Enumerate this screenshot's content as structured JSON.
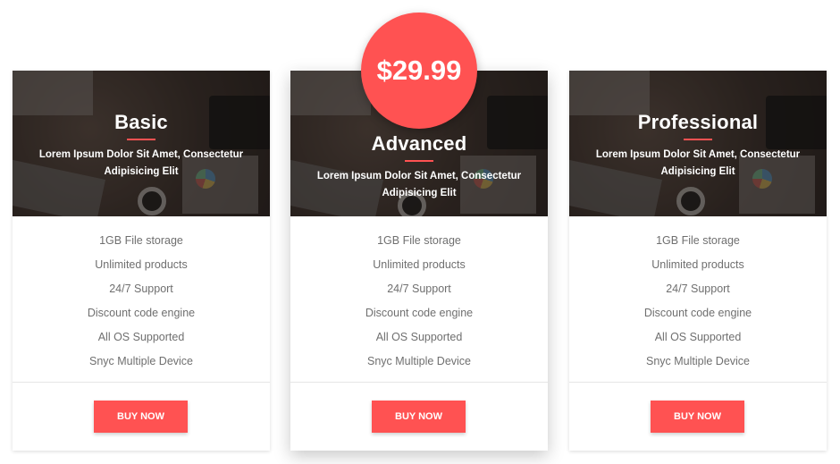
{
  "accent_color": "#ff5252",
  "featured_price": "$29.99",
  "plans": [
    {
      "name": "Basic",
      "description": "Lorem Ipsum Dolor Sit Amet, Consectetur Adipisicing Elit",
      "features": [
        "1GB File storage",
        "Unlimited products",
        "24/7 Support",
        "Discount code engine",
        "All OS Supported",
        "Snyc Multiple Device"
      ],
      "button_label": "BUY NOW"
    },
    {
      "name": "Advanced",
      "description": "Lorem Ipsum Dolor Sit Amet, Consectetur Adipisicing Elit",
      "features": [
        "1GB File storage",
        "Unlimited products",
        "24/7 Support",
        "Discount code engine",
        "All OS Supported",
        "Snyc Multiple Device"
      ],
      "button_label": "BUY NOW"
    },
    {
      "name": "Professional",
      "description": "Lorem Ipsum Dolor Sit Amet, Consectetur Adipisicing Elit",
      "features": [
        "1GB File storage",
        "Unlimited products",
        "24/7 Support",
        "Discount code engine",
        "All OS Supported",
        "Snyc Multiple Device"
      ],
      "button_label": "BUY NOW"
    }
  ]
}
